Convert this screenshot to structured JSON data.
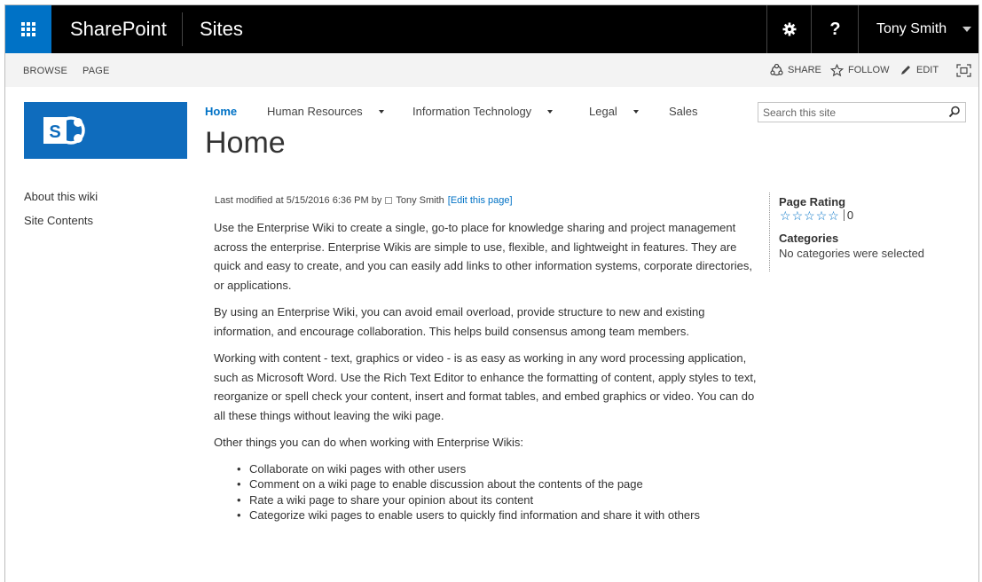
{
  "suite_bar": {
    "brand": "SharePoint",
    "site_title": "Sites",
    "help_label": "?",
    "user_name": "Tony Smith",
    "accent_color": "#0072c6"
  },
  "ribbon": {
    "tabs": [
      "BROWSE",
      "PAGE"
    ],
    "actions": {
      "share": "SHARE",
      "follow": "FOLLOW",
      "edit": "EDIT"
    }
  },
  "top_nav": [
    {
      "label": "Home",
      "active": true
    },
    {
      "label": "Human Resources",
      "has_dropdown": true
    },
    {
      "label": "Information Technology",
      "has_dropdown": true
    },
    {
      "label": "Legal",
      "has_dropdown": true
    },
    {
      "label": "Sales"
    }
  ],
  "page_title": "Home",
  "search": {
    "placeholder": "Search this site"
  },
  "quick_launch": [
    "About this wiki",
    "Site Contents"
  ],
  "last_modified": {
    "prefix": "Last modified at 5/15/2016 6:36 PM by",
    "author": "Tony Smith",
    "edit_link": "[Edit this page]"
  },
  "content": {
    "paragraphs": [
      "Use the Enterprise Wiki to create a single, go-to place for knowledge sharing and project management across the enterprise. Enterprise Wikis are simple to use, flexible, and lightweight in features. They are quick and easy to create, and you can easily add links to other information systems, corporate directories, or applications.",
      "By using an Enterprise Wiki, you can avoid email overload, provide structure to new and existing information, and encourage collaboration. This helps build consensus among team members.",
      "Working with content - text, graphics or video - is as easy as working in any word processing application, such as Microsoft Word. Use the Rich Text Editor to enhance the formatting of content, apply styles to text, reorganize or spell check your content, insert and format tables, and embed graphics or video. You can do all these things without leaving the wiki page.",
      "Other things you can do when working with Enterprise Wikis:"
    ],
    "bullets": [
      "Collaborate on wiki pages with other users",
      "Comment on a wiki page to enable discussion about the contents of the page",
      "Rate a wiki page to share your opinion about its content",
      "Categorize wiki pages to enable users to quickly find information and share it with others"
    ]
  },
  "right_panel": {
    "rating_heading": "Page Rating",
    "rating_count": "0",
    "categories_heading": "Categories",
    "categories_text": "No categories were selected"
  }
}
